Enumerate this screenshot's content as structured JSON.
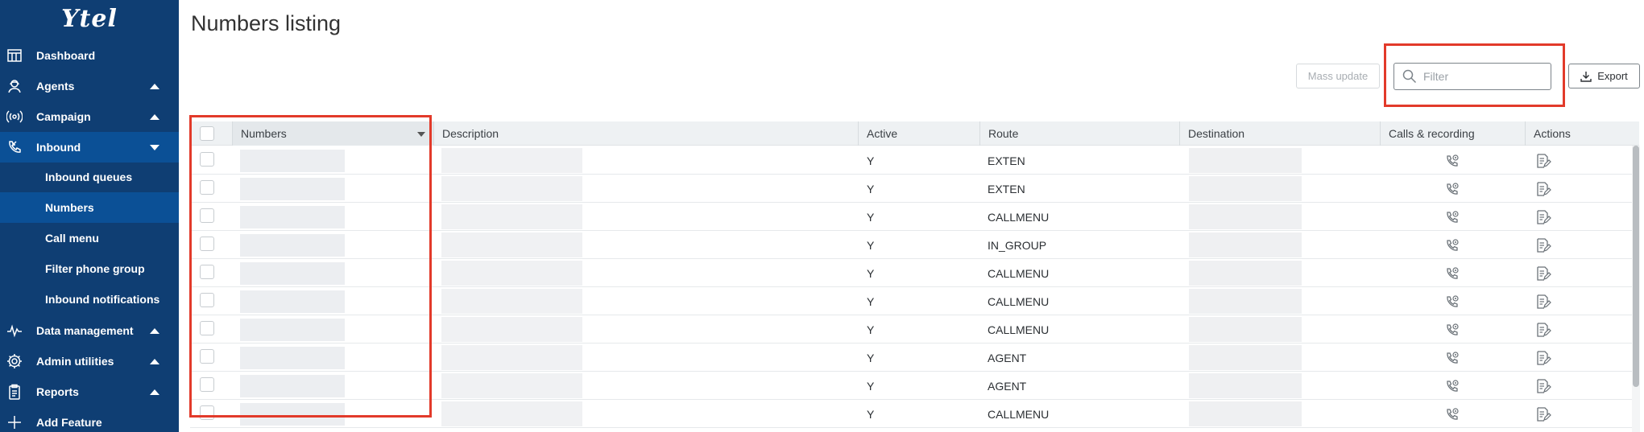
{
  "brand": {
    "logo": "Ytel"
  },
  "sidebar": {
    "items": [
      {
        "label": "Dashboard",
        "icon": "dashboard-icon"
      },
      {
        "label": "Agents",
        "icon": "agent-icon"
      },
      {
        "label": "Campaign",
        "icon": "campaign-icon"
      },
      {
        "label": "Inbound",
        "icon": "phone-incoming-icon"
      },
      {
        "label": "Data management",
        "icon": "pulse-icon"
      },
      {
        "label": "Admin utilities",
        "icon": "gear-icon"
      },
      {
        "label": "Reports",
        "icon": "clipboard-icon"
      },
      {
        "label": "Add Feature",
        "icon": "plus-icon"
      }
    ],
    "inbound_submenu": [
      {
        "label": "Inbound queues"
      },
      {
        "label": "Numbers"
      },
      {
        "label": "Call menu"
      },
      {
        "label": "Filter phone group"
      },
      {
        "label": "Inbound notifications"
      }
    ]
  },
  "page": {
    "title": "Numbers listing"
  },
  "toolbar": {
    "mass_update": "Mass update",
    "filter_placeholder": "Filter",
    "export": "Export"
  },
  "table": {
    "columns": [
      "Numbers",
      "Description",
      "Active",
      "Route",
      "Destination",
      "Calls & recording",
      "Actions"
    ],
    "rows": [
      {
        "active": "Y",
        "route": "EXTEN"
      },
      {
        "active": "Y",
        "route": "EXTEN"
      },
      {
        "active": "Y",
        "route": "CALLMENU"
      },
      {
        "active": "Y",
        "route": "IN_GROUP"
      },
      {
        "active": "Y",
        "route": "CALLMENU"
      },
      {
        "active": "Y",
        "route": "CALLMENU"
      },
      {
        "active": "Y",
        "route": "CALLMENU"
      },
      {
        "active": "Y",
        "route": "AGENT"
      },
      {
        "active": "Y",
        "route": "AGENT"
      },
      {
        "active": "Y",
        "route": "CALLMENU"
      }
    ]
  },
  "colors": {
    "sidebar": "#0f3e73",
    "sidebar_active": "#0b5096",
    "highlight": "#e23a2a",
    "header_bg": "#eef1f3"
  }
}
